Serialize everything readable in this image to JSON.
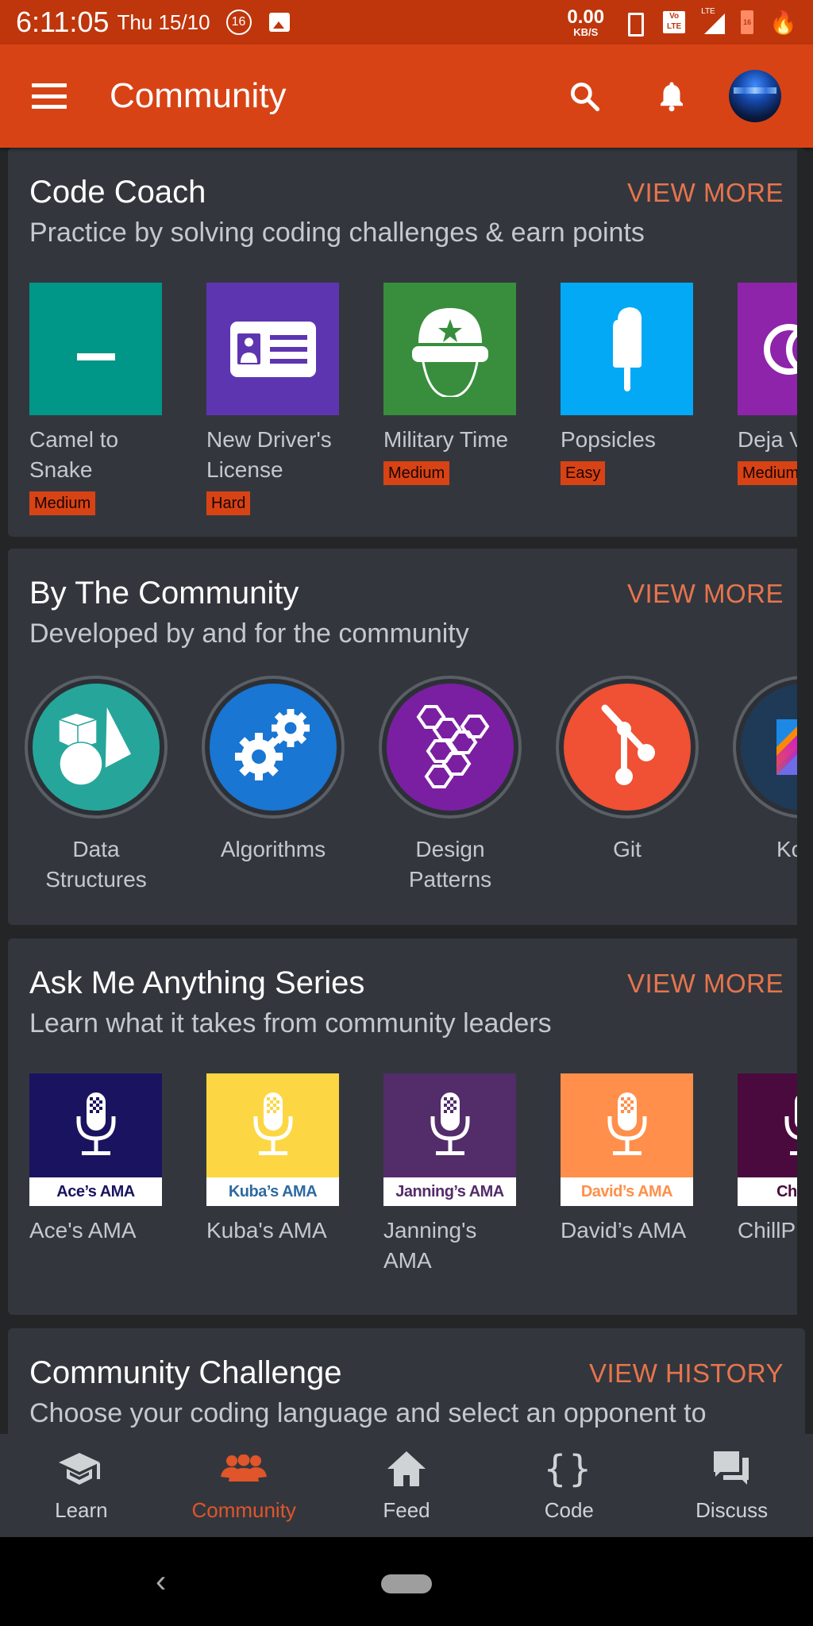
{
  "status_bar": {
    "time": "6:11:05",
    "date": "Thu 15/10",
    "notification_count": "16",
    "net_speed_value": "0.00",
    "net_speed_unit": "KB/S",
    "volte": "Vo LTE",
    "signal_label": "LTE",
    "battery_level": "16"
  },
  "app_bar": {
    "title": "Community",
    "menu_icon": "hamburger-icon",
    "search_icon": "search-icon",
    "notification_icon": "bell-icon",
    "avatar": "user-avatar"
  },
  "colors": {
    "accent": "#d84315",
    "status_bar": "#bf360c",
    "card_bg": "#33373d",
    "page_bg": "#242526",
    "link": "#e8744d"
  },
  "sections": {
    "code_coach": {
      "title": "Code Coach",
      "action": "VIEW MORE",
      "subtitle": "Practice by solving coding challenges & earn points",
      "items": [
        {
          "label": "Camel to Snake",
          "difficulty": "Medium",
          "color": "#009688",
          "icon": "underscore-icon"
        },
        {
          "label": "New Driver's License",
          "difficulty": "Hard",
          "color": "#5e35b1",
          "icon": "id-card-icon"
        },
        {
          "label": "Military Time",
          "difficulty": "Medium",
          "color": "#388e3c",
          "icon": "helmet-icon"
        },
        {
          "label": "Popsicles",
          "difficulty": "Easy",
          "color": "#03a9f4",
          "icon": "popsicle-icon"
        },
        {
          "label": "Deja Vu",
          "difficulty": "Medium",
          "color": "#8e24aa",
          "icon": "double-circle-icon"
        }
      ]
    },
    "by_community": {
      "title": "By The Community",
      "action": "VIEW MORE",
      "subtitle": "Developed by and for the community",
      "items": [
        {
          "label": "Data Structures",
          "color": "#26a69a",
          "icon": "shapes-icon"
        },
        {
          "label": "Algorithms",
          "color": "#1976d2",
          "icon": "gears-icon"
        },
        {
          "label": "Design Patterns",
          "color": "#7b1fa2",
          "icon": "hexagons-icon"
        },
        {
          "label": "Git",
          "color": "#f05033",
          "icon": "git-branch-icon"
        },
        {
          "label": "Kotlin",
          "color": "#1e3a56",
          "icon": "kotlin-logo-icon"
        }
      ]
    },
    "ama": {
      "title": "Ask Me Anything Series",
      "action": "VIEW MORE",
      "subtitle": "Learn what it takes from community leaders",
      "items": [
        {
          "label": "Ace's AMA",
          "banner": "Ace’s AMA",
          "color": "#1a1460",
          "banner_color": "#1a1460"
        },
        {
          "label": "Kuba's AMA",
          "banner": "Kuba’s AMA",
          "color": "#fdd643",
          "banner_color": "#2e6aa0"
        },
        {
          "label": "Janning's AMA",
          "banner": "Janning’s AMA",
          "color": "#532c6a",
          "banner_color": "#532c6a"
        },
        {
          "label": "David’s AMA",
          "banner": "David’s AMA",
          "color": "#ff8f4a",
          "banner_color": "#ff8f4a"
        },
        {
          "label": "ChillPill AMA",
          "banner": "ChillPill",
          "color": "#4a0a3e",
          "banner_color": "#4a0a3e"
        }
      ]
    },
    "challenge": {
      "title": "Community Challenge",
      "action": "VIEW HISTORY",
      "subtitle": "Choose your coding language and select an opponent to"
    }
  },
  "bottom_nav": {
    "items": [
      {
        "label": "Learn",
        "icon": "graduation-cap-icon",
        "active": false
      },
      {
        "label": "Community",
        "icon": "people-icon",
        "active": true
      },
      {
        "label": "Feed",
        "icon": "home-icon",
        "active": false
      },
      {
        "label": "Code",
        "icon": "braces-icon",
        "active": false
      },
      {
        "label": "Discuss",
        "icon": "chat-icon",
        "active": false
      }
    ]
  }
}
